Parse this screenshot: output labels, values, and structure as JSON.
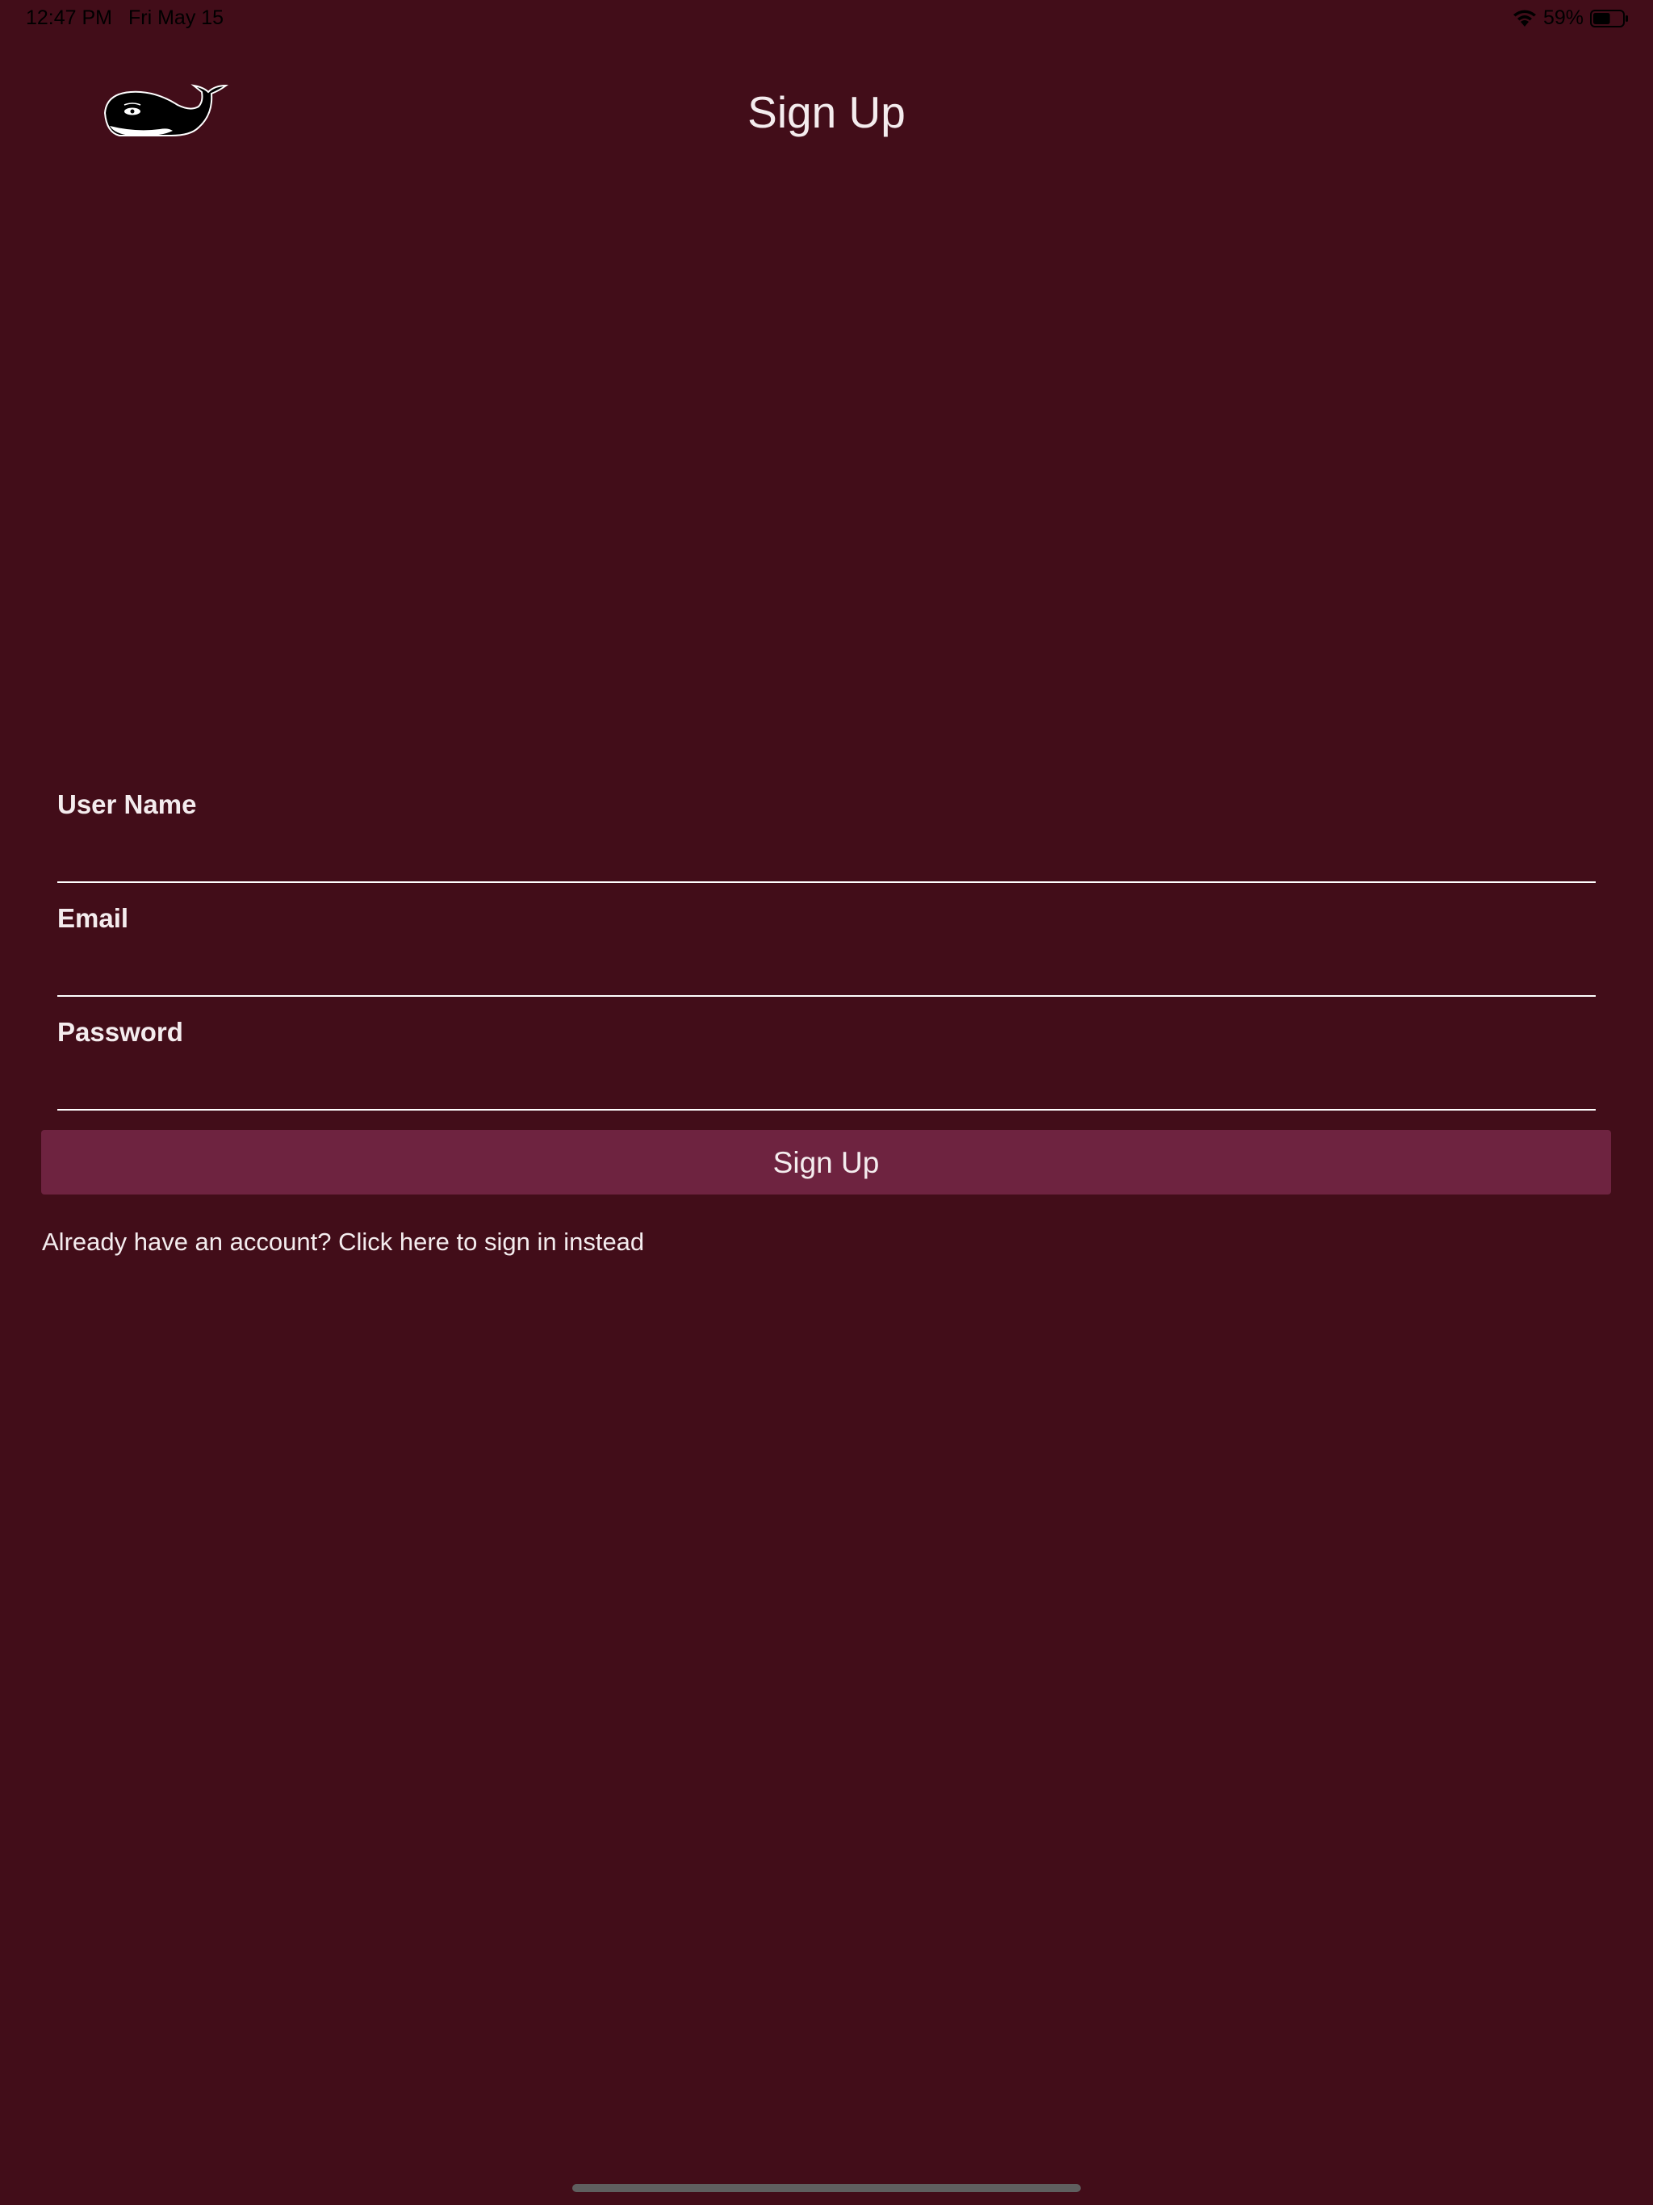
{
  "status_bar": {
    "time": "12:47 PM",
    "date": "Fri May 15",
    "battery_percent": "59%",
    "battery_level": 0.59,
    "wifi_icon": "wifi-icon",
    "battery_icon": "battery-icon"
  },
  "header": {
    "title": "Sign Up",
    "logo_icon": "whale-logo-icon"
  },
  "form": {
    "username": {
      "label": "User Name",
      "value": "",
      "placeholder": ""
    },
    "email": {
      "label": "Email",
      "value": "",
      "placeholder": ""
    },
    "password": {
      "label": "Password",
      "value": "",
      "placeholder": ""
    }
  },
  "actions": {
    "signup_label": "Sign Up",
    "signin_link": "Already have an account? Click here to sign in instead"
  },
  "colors": {
    "background": "#420d19",
    "button": "#6e2340",
    "text": "#f4ecee",
    "underline": "#ffffff"
  }
}
